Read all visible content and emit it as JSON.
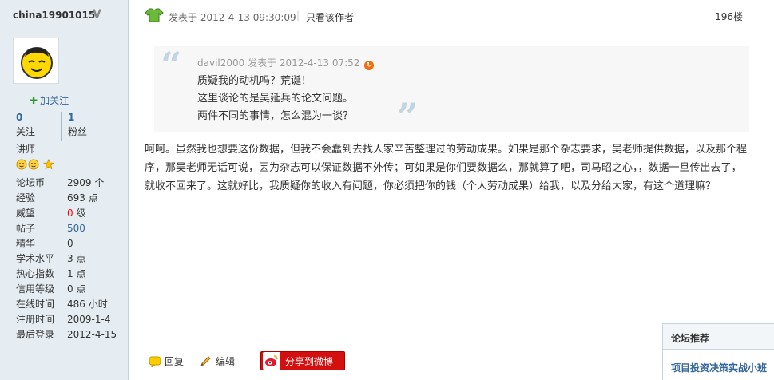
{
  "user": {
    "name": "china19901015",
    "level_mark": "V",
    "follow_label": "加关注",
    "follow_count": "0",
    "follow_label_text": "关注",
    "fans_count": "1",
    "fans_label": "粉丝",
    "title": "讲师",
    "stats": [
      {
        "key": "论坛币",
        "value": "2909 个"
      },
      {
        "key": "经验",
        "value": "693 点"
      },
      {
        "key": "威望",
        "value_num": "0",
        "value_unit": " 级"
      },
      {
        "key": "帖子",
        "value": "500"
      },
      {
        "key": "精华",
        "value": "0"
      },
      {
        "key": "学术水平",
        "value": "3 点"
      },
      {
        "key": "热心指数",
        "value": "1 点"
      },
      {
        "key": "信用等级",
        "value": "0 点"
      },
      {
        "key": "在线时间",
        "value": "486 小时"
      },
      {
        "key": "注册时间",
        "value": "2009-1-4"
      },
      {
        "key": "最后登录",
        "value": "2012-4-15"
      }
    ]
  },
  "post": {
    "posted_at": "发表于  2012-4-13 09:30:09",
    "only_author": "只看该作者",
    "floor": "196楼",
    "quote": {
      "author": "davil2000 发表于  2012-4-13 07:52",
      "lines": [
        "质疑我的动机吗？荒诞！",
        "这里谈论的是吴延兵的论文问题。",
        "两件不同的事情，怎么混为一谈？"
      ]
    },
    "body": "呵呵。虽然我也想要这份数据，但我不会蠢到去找人家辛苦整理过的劳动成果。如果是那个杂志要求，吴老师提供数据，以及那个程序，那吴老师无话可说，因为杂志可以保证数据不外传；可如果是你们要数据么，那就算了吧，司马昭之心，，数据一旦传出去了，就收不回来了。这就好比，我质疑你的收入有问题，你必须把你的钱（个人劳动成果）给我，以及分给大家，有这个道理嘛？"
  },
  "actions": {
    "reply": "回复",
    "edit": "编辑",
    "share": "分享到微博"
  },
  "recommend": {
    "title": "论坛推荐",
    "item": "项目投资决策实战小班"
  }
}
